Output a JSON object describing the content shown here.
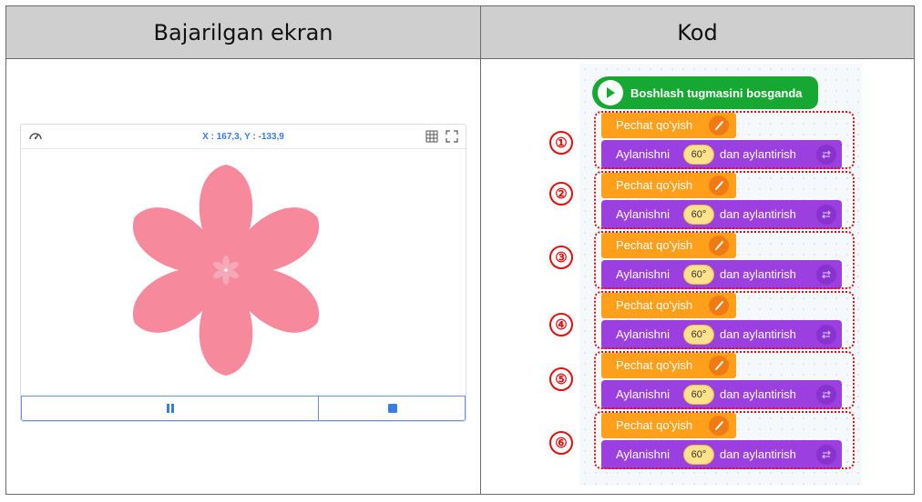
{
  "headers": {
    "left": "Bajarilgan ekran",
    "right": "Kod"
  },
  "stage": {
    "coords": "X : 167,3, Y : -133,9"
  },
  "colors": {
    "flower": "#f7899c",
    "flower_center": "#f4a8b8",
    "hat": "#16a832",
    "stamp": "#ff9f1a",
    "rotate": "#9b3fe0",
    "highlight": "#e01010"
  },
  "code": {
    "hat_label": "Boshlash tugmasini bosganda",
    "stamp_label": "Pechat qo'yish",
    "rotate_label_a": "Aylanishni",
    "rotate_value": "60°",
    "rotate_label_b": "dan aylantirish",
    "numbers": [
      "①",
      "②",
      "③",
      "④",
      "⑤",
      "⑥"
    ]
  }
}
